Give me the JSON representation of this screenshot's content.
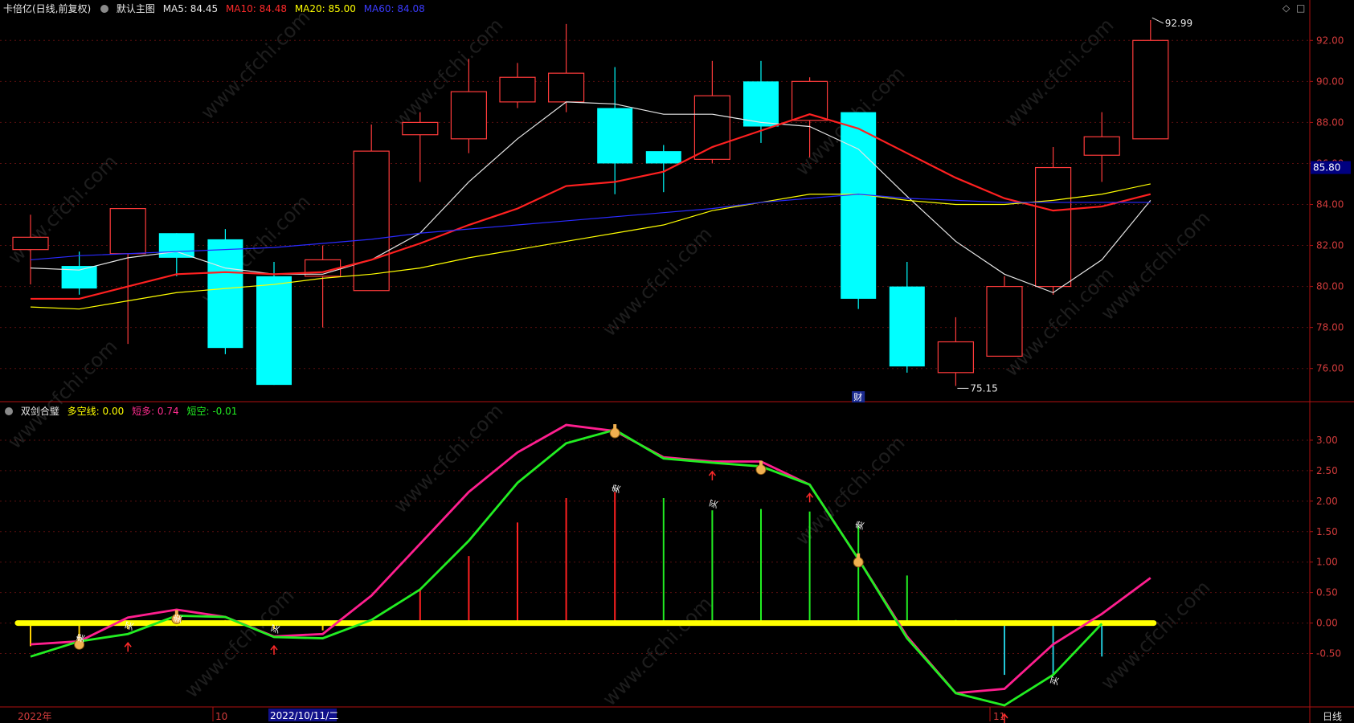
{
  "top_header": {
    "title": "卡倍亿(日线,前复权)",
    "chart_name": "默认主图",
    "ma5": "MA5: 84.45",
    "ma10": "MA10: 84.48",
    "ma20": "MA20: 85.00",
    "ma60": "MA60: 84.08"
  },
  "bottom_header": {
    "name": "双剑合璧",
    "duokong": "多空线: 0.00",
    "duanduo": "短多: 0.74",
    "duankong": "短空: -0.01"
  },
  "window_buttons": [
    "◇",
    "□"
  ],
  "price_marker": "85.80",
  "high_label": "92.99",
  "low_label": "75.15",
  "cai_label": "财",
  "period_label": "日线",
  "x_labels": [
    "2022年",
    "10",
    "2022/10/11/二",
    "11"
  ],
  "watermark": "www.cfchi.com",
  "colors": {
    "up": "#ff3b3b",
    "down": "#00ffff",
    "ma5": "#e6e6e6",
    "ma10": "#ff2020",
    "ma20": "#ffff00",
    "ma60": "#2a2aff",
    "duanduo": "#ff1f8f",
    "duankong": "#22ee22",
    "zero": "#ffff00",
    "axis": "#b01010"
  },
  "chart_data": [
    {
      "type": "candlestick",
      "title": "卡倍亿(日线,前复权)",
      "ylim": [
        74.5,
        93.5
      ],
      "y_ticks": [
        "76.00",
        "78.00",
        "80.00",
        "82.00",
        "84.00",
        "86.00",
        "88.00",
        "90.00",
        "92.00"
      ],
      "candles": [
        {
          "o": 81.8,
          "h": 83.5,
          "l": 80.1,
          "c": 82.4
        },
        {
          "o": 81.0,
          "h": 81.7,
          "l": 79.6,
          "c": 79.9
        },
        {
          "o": 81.6,
          "h": 83.8,
          "l": 77.2,
          "c": 83.8
        },
        {
          "o": 82.6,
          "h": 82.6,
          "l": 80.5,
          "c": 81.4
        },
        {
          "o": 82.3,
          "h": 82.8,
          "l": 76.7,
          "c": 77.0
        },
        {
          "o": 80.5,
          "h": 81.2,
          "l": 75.2,
          "c": 75.2
        },
        {
          "o": 80.5,
          "h": 82.0,
          "l": 78.0,
          "c": 81.3
        },
        {
          "o": 79.8,
          "h": 87.9,
          "l": 79.8,
          "c": 86.6
        },
        {
          "o": 87.4,
          "h": 88.5,
          "l": 85.1,
          "c": 88.0
        },
        {
          "o": 87.2,
          "h": 91.1,
          "l": 86.5,
          "c": 89.5
        },
        {
          "o": 89.0,
          "h": 90.9,
          "l": 88.7,
          "c": 90.2
        },
        {
          "o": 89.0,
          "h": 92.8,
          "l": 88.5,
          "c": 90.4
        },
        {
          "o": 88.7,
          "h": 90.7,
          "l": 84.5,
          "c": 86.0
        },
        {
          "o": 86.6,
          "h": 86.9,
          "l": 84.6,
          "c": 86.0
        },
        {
          "o": 86.2,
          "h": 91.0,
          "l": 86.0,
          "c": 89.3
        },
        {
          "o": 90.0,
          "h": 91.0,
          "l": 87.0,
          "c": 87.8
        },
        {
          "o": 88.1,
          "h": 90.2,
          "l": 86.3,
          "c": 90.0
        },
        {
          "o": 88.5,
          "h": 88.5,
          "l": 78.9,
          "c": 79.4
        },
        {
          "o": 80.0,
          "h": 81.2,
          "l": 75.8,
          "c": 76.1
        },
        {
          "o": 75.8,
          "h": 78.5,
          "l": 75.15,
          "c": 77.3
        },
        {
          "o": 76.6,
          "h": 80.5,
          "l": 76.6,
          "c": 80.0
        },
        {
          "o": 80.0,
          "h": 86.8,
          "l": 79.6,
          "c": 85.8
        },
        {
          "o": 86.4,
          "h": 88.5,
          "l": 85.1,
          "c": 87.3
        },
        {
          "o": 87.2,
          "h": 92.99,
          "l": 87.2,
          "c": 92.0
        }
      ],
      "series": [
        {
          "name": "MA5",
          "values": [
            80.9,
            80.8,
            81.4,
            81.7,
            80.9,
            80.6,
            80.6,
            81.3,
            82.6,
            85.1,
            87.2,
            89.0,
            88.9,
            88.4,
            88.4,
            88.0,
            87.8,
            86.7,
            84.4,
            82.2,
            80.6,
            79.7,
            81.3,
            84.2
          ]
        },
        {
          "name": "MA10",
          "values": [
            79.4,
            79.4,
            80.0,
            80.6,
            80.7,
            80.6,
            80.7,
            81.3,
            82.1,
            83.0,
            83.8,
            84.9,
            85.1,
            85.6,
            86.8,
            87.6,
            88.4,
            87.7,
            86.5,
            85.3,
            84.3,
            83.7,
            83.9,
            84.5
          ]
        },
        {
          "name": "MA20",
          "values": [
            79.0,
            78.9,
            79.3,
            79.7,
            79.9,
            80.1,
            80.4,
            80.6,
            80.9,
            81.4,
            81.8,
            82.2,
            82.6,
            83.0,
            83.7,
            84.1,
            84.5,
            84.5,
            84.2,
            84.0,
            84.0,
            84.2,
            84.5,
            85.0
          ]
        },
        {
          "name": "MA60",
          "values": [
            81.3,
            81.5,
            81.6,
            81.7,
            81.8,
            81.9,
            82.1,
            82.3,
            82.6,
            82.8,
            83.0,
            83.2,
            83.4,
            83.6,
            83.8,
            84.1,
            84.3,
            84.5,
            84.3,
            84.2,
            84.1,
            84.1,
            84.1,
            84.1
          ]
        }
      ]
    },
    {
      "type": "line",
      "title": "双剑合璧",
      "ylim": [
        -1.35,
        3.5
      ],
      "y_ticks": [
        "-0.50",
        "0.00",
        "0.50",
        "1.00",
        "1.50",
        "2.00",
        "2.50",
        "3.00"
      ],
      "series": [
        {
          "name": "短多",
          "values": [
            -0.35,
            -0.3,
            0.09,
            0.22,
            0.1,
            -0.22,
            -0.18,
            0.45,
            1.3,
            2.15,
            2.8,
            3.25,
            3.15,
            2.72,
            2.65,
            2.65,
            2.27,
            1.05,
            -0.22,
            -1.15,
            -1.08,
            -0.35,
            0.15,
            0.74
          ]
        },
        {
          "name": "短空",
          "values": [
            -0.55,
            -0.3,
            -0.18,
            0.12,
            0.1,
            -0.23,
            -0.25,
            0.05,
            0.55,
            1.35,
            2.3,
            2.95,
            3.17,
            2.7,
            2.63,
            2.57,
            2.27,
            1.05,
            -0.25,
            -1.15,
            -1.35,
            -0.85,
            -0.01
          ]
        },
        {
          "name": "多空线",
          "values": [
            0,
            0,
            0,
            0,
            0,
            0,
            0,
            0,
            0,
            0,
            0,
            0,
            0,
            0,
            0,
            0,
            0,
            0,
            0,
            0,
            0,
            0,
            0,
            0
          ]
        }
      ],
      "bars": [
        -0.38,
        -0.25,
        -0.1,
        -0.05,
        0.05,
        -0.1,
        -0.12,
        0.05,
        0.55,
        1.1,
        1.65,
        2.05,
        2.15,
        2.05,
        1.85,
        1.87,
        1.83,
        1.6,
        0.78,
        0.05,
        -0.85,
        -0.85,
        -0.55,
        0
      ],
      "arrow_markers": [
        2,
        5,
        14,
        16,
        20
      ],
      "finger_markers": [
        1,
        3,
        12,
        15,
        17
      ],
      "text_markers": [
        {
          "i": 1,
          "v": -0.25,
          "text": "卖"
        },
        {
          "i": 2,
          "v": -0.05,
          "text": "买"
        },
        {
          "i": 3,
          "v": 0.07,
          "text": "卖"
        },
        {
          "i": 5,
          "v": -0.1,
          "text": "买"
        },
        {
          "i": 12,
          "v": 2.2,
          "text": "卖"
        },
        {
          "i": 14,
          "v": 1.95,
          "text": "买"
        },
        {
          "i": 17,
          "v": 1.6,
          "text": "卖"
        },
        {
          "i": 21,
          "v": -0.95,
          "text": "买"
        }
      ]
    }
  ]
}
